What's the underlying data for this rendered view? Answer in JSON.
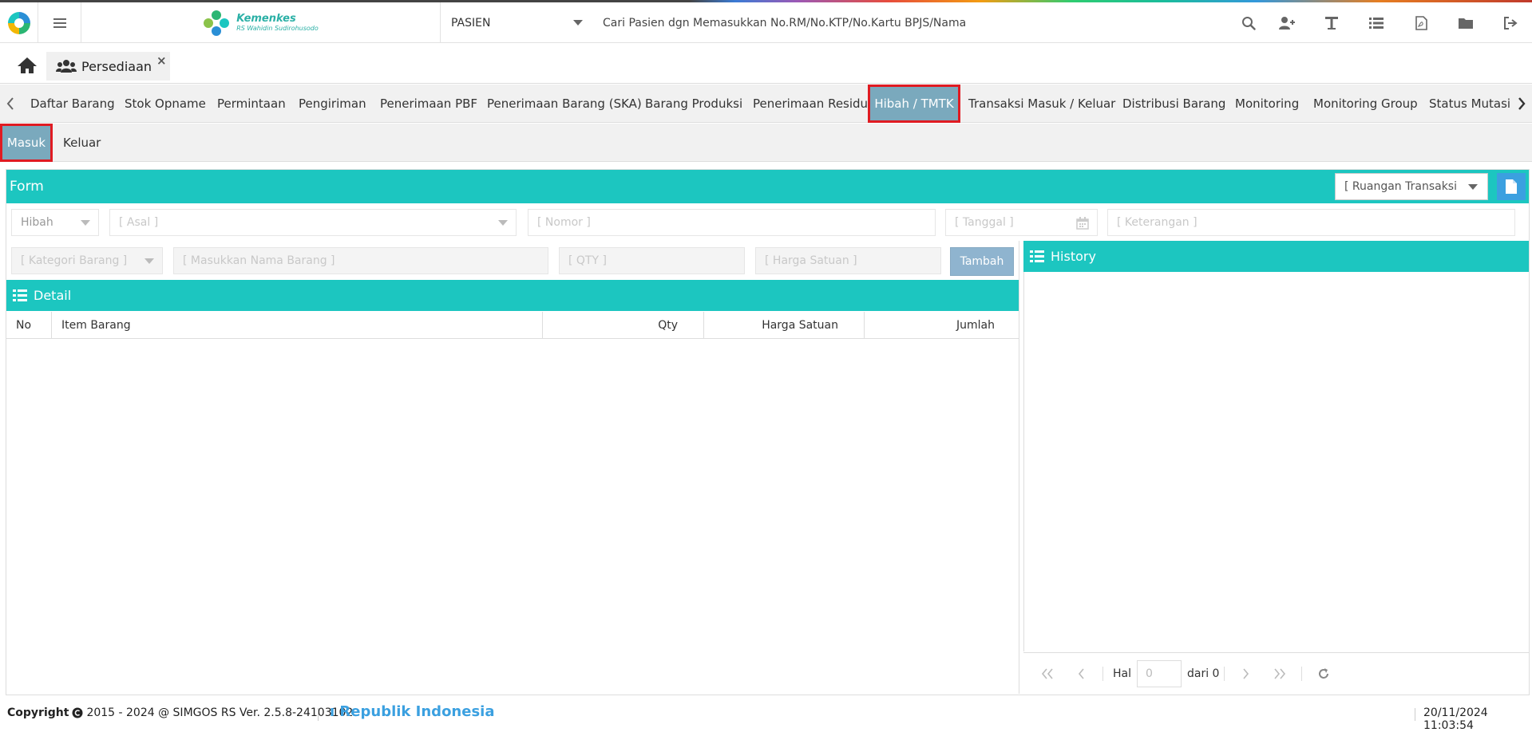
{
  "header": {
    "brand_name": "Kemenkes",
    "brand_subtitle": "RS Wahidin Sudirohusodo",
    "patient_select_value": "PASIEN",
    "patient_search_placeholder": "Cari Pasien dgn Memasukkan No.RM/No.KTP/No.Kartu BPJS/Nama",
    "icons": [
      "search-icon",
      "add-user-icon",
      "text-icon",
      "list-icon",
      "pdf-icon",
      "folder-icon",
      "logout-icon"
    ]
  },
  "module_tabs": {
    "active_label": "Persediaan",
    "close_symbol": "×"
  },
  "nav_tabs": [
    {
      "label": "Daftar Barang",
      "active": false
    },
    {
      "label": "Stok Opname",
      "active": false
    },
    {
      "label": "Permintaan",
      "active": false
    },
    {
      "label": "Pengiriman",
      "active": false
    },
    {
      "label": "Penerimaan PBF",
      "active": false
    },
    {
      "label": "Penerimaan Barang (SKA)",
      "active": false
    },
    {
      "label": "Barang Produksi",
      "active": false
    },
    {
      "label": "Penerimaan Residu",
      "active": false
    },
    {
      "label": "Hibah / TMTK",
      "active": true
    },
    {
      "label": "Transaksi Masuk / Keluar",
      "active": false
    },
    {
      "label": "Distribusi Barang",
      "active": false
    },
    {
      "label": "Monitoring",
      "active": false
    },
    {
      "label": "Monitoring Group",
      "active": false
    },
    {
      "label": "Status Mutasi E",
      "active": false
    }
  ],
  "sub_tabs": [
    {
      "label": "Masuk",
      "active": true
    },
    {
      "label": "Keluar",
      "active": false
    }
  ],
  "form": {
    "title": "Form",
    "ruangan_select_value": "[ Ruangan Transaksi",
    "jenis_value": "Hibah",
    "asal_placeholder": "[ Asal ]",
    "nomor_placeholder": "[ Nomor ]",
    "tanggal_placeholder": "[ Tanggal ]",
    "keterangan_placeholder": "[ Keterangan ]",
    "kategori_placeholder": "[ Kategori Barang ]",
    "nama_barang_placeholder": "[ Masukkan Nama Barang ]",
    "qty_placeholder": "[ QTY ]",
    "harga_placeholder": "[ Harga Satuan ]",
    "tambah_label": "Tambah"
  },
  "detail": {
    "title": "Detail",
    "columns": [
      "No",
      "Item Barang",
      "Qty",
      "Harga Satuan",
      "Jumlah"
    ],
    "rows": []
  },
  "history": {
    "title": "History",
    "hal_label": "Hal",
    "hal_placeholder": "0",
    "of_label": "dari 0"
  },
  "footer": {
    "copyright": "Copyright",
    "copyright_rest": "2015 - 2024 @ SIMGOS RS Ver. 2.5.8-24103102",
    "ticker": "ı Republik Indonesia",
    "datetime": "20/11/2024 11:03:54"
  },
  "colors": {
    "teal": "#1cc6c0",
    "active_tab": "#7aa9bd",
    "highlight": "#e01b22",
    "accent_blue": "#3ba0e0"
  }
}
